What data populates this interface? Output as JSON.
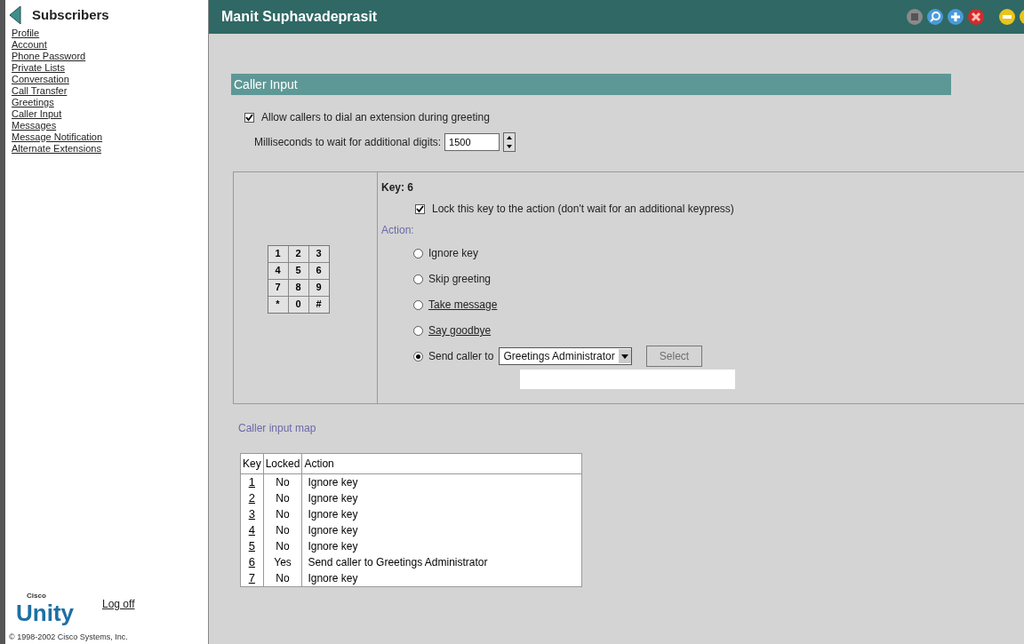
{
  "sidebar": {
    "title": "Subscribers",
    "items": [
      "Profile",
      "Account",
      "Phone Password",
      "Private Lists",
      "Conversation",
      "Call Transfer",
      "Greetings",
      "Caller Input",
      "Messages",
      "Message Notification",
      "Alternate Extensions"
    ],
    "logo_small": "Cisco",
    "logo": "Unity",
    "logoff": "Log off",
    "copyright": "© 1998-2002 Cisco Systems, Inc."
  },
  "header": {
    "title": "Manit Suphavadeprasit"
  },
  "section": {
    "title": "Caller Input"
  },
  "allow_dial": {
    "label": "Allow callers to dial an extension during greeting",
    "checked": true
  },
  "wait": {
    "label": "Milliseconds to wait for additional digits:",
    "value": "1500"
  },
  "keypad": [
    "1",
    "2",
    "3",
    "4",
    "5",
    "6",
    "7",
    "8",
    "9",
    "*",
    "0",
    "#"
  ],
  "key_panel": {
    "title": "Key: 6",
    "lock": {
      "label": "Lock this key to the action (don't wait for an additional keypress)",
      "checked": true
    },
    "action_label": "Action:",
    "options": [
      {
        "kind": "plain",
        "label": "Ignore key",
        "selected": false
      },
      {
        "kind": "plain",
        "label": "Skip greeting",
        "selected": false
      },
      {
        "kind": "link",
        "label": "Take message",
        "selected": false
      },
      {
        "kind": "link",
        "label": "Say goodbye",
        "selected": false
      },
      {
        "kind": "send",
        "label": "Send caller to",
        "selected": true,
        "dropdown": "Greetings Administrator",
        "button": "Select",
        "button_disabled": true
      }
    ]
  },
  "map": {
    "title": "Caller input map",
    "columns": [
      "Key",
      "Locked",
      "Action"
    ],
    "rows": [
      {
        "key": "1",
        "locked": "No",
        "action": "Ignore key"
      },
      {
        "key": "2",
        "locked": "No",
        "action": "Ignore key"
      },
      {
        "key": "3",
        "locked": "No",
        "action": "Ignore key"
      },
      {
        "key": "4",
        "locked": "No",
        "action": "Ignore key"
      },
      {
        "key": "5",
        "locked": "No",
        "action": "Ignore key"
      },
      {
        "key": "6",
        "locked": "Yes",
        "action": "Send caller to Greetings Administrator"
      },
      {
        "key": "7",
        "locked": "No",
        "action": "Ignore key"
      }
    ]
  }
}
